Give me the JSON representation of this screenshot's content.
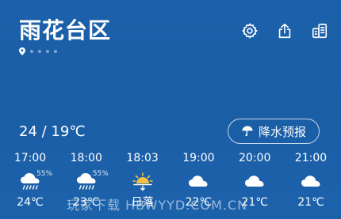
{
  "header": {
    "city": "雨花台区",
    "page_dots": 5
  },
  "icons": {
    "settings": "settings-gear-icon",
    "share": "share-icon",
    "layout": "city-list-icon"
  },
  "today": {
    "temp_range": "24 / 19℃"
  },
  "precip_button": {
    "label": "降水预报",
    "icon": "umbrella-icon"
  },
  "hourly": [
    {
      "time": "17:00",
      "icon": "rain-cloud-icon",
      "pop": "55%",
      "temp": "24℃"
    },
    {
      "time": "18:00",
      "icon": "rain-cloud-icon",
      "pop": "55%",
      "temp": "23℃"
    },
    {
      "time": "18:03",
      "icon": "sunset-icon",
      "pop": "",
      "temp": "日落"
    },
    {
      "time": "19:00",
      "icon": "cloud-icon",
      "pop": "",
      "temp": "22℃"
    },
    {
      "time": "20:00",
      "icon": "cloud-icon",
      "pop": "",
      "temp": "21℃"
    },
    {
      "time": "21:00",
      "icon": "cloud-icon",
      "pop": "",
      "temp": "21℃"
    }
  ],
  "watermark": "玩家下载 HBWYYD.COM.CN",
  "colors": {
    "background": "#1a5fa8",
    "text": "#ffffff",
    "sun": "#f5c242"
  }
}
